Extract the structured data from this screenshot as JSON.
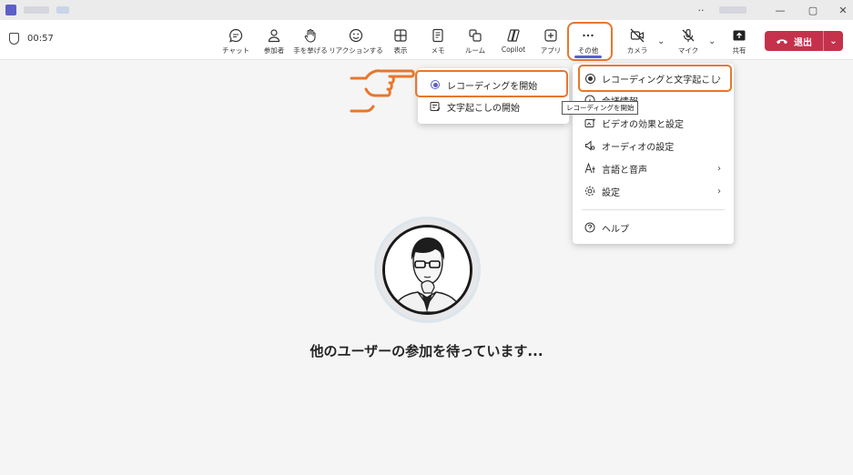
{
  "call": {
    "timer": "00:57"
  },
  "toolbar": {
    "items": [
      {
        "label": "チャット",
        "icon": "chat-icon"
      },
      {
        "label": "参加者",
        "icon": "people-icon"
      },
      {
        "label": "手を挙げる",
        "icon": "raise-hand-icon"
      },
      {
        "label": "リアクションする",
        "icon": "emoji-icon"
      },
      {
        "label": "表示",
        "icon": "grid-view-icon"
      },
      {
        "label": "メモ",
        "icon": "notes-icon"
      },
      {
        "label": "ルーム",
        "icon": "breakout-rooms-icon"
      },
      {
        "label": "Copilot",
        "icon": "copilot-icon"
      },
      {
        "label": "アプリ",
        "icon": "apps-icon"
      },
      {
        "label": "その他",
        "icon": "more-icon"
      },
      {
        "label": "カメラ",
        "icon": "camera-off-icon"
      },
      {
        "label": "マイク",
        "icon": "mic-off-icon"
      },
      {
        "label": "共有",
        "icon": "share-icon"
      }
    ],
    "leave_label": "退出"
  },
  "more_menu": {
    "items": [
      {
        "label": "レコーディングと文字起こし",
        "icon": "record-icon",
        "submenu": true
      },
      {
        "label": "会議情報",
        "icon": "info-icon",
        "submenu": false
      },
      {
        "label": "ビデオの効果と設定",
        "icon": "video-effects-icon",
        "submenu": false
      },
      {
        "label": "オーディオの設定",
        "icon": "speaker-icon",
        "submenu": false
      },
      {
        "label": "言語と音声",
        "icon": "language-icon",
        "submenu": true
      },
      {
        "label": "設定",
        "icon": "settings-icon",
        "submenu": true
      },
      {
        "label": "ヘルプ",
        "icon": "help-icon",
        "submenu": false
      }
    ]
  },
  "recording_submenu": {
    "items": [
      {
        "label": "レコーディングを開始",
        "icon": "record-radio-icon"
      },
      {
        "label": "文字起こしの開始",
        "icon": "transcript-icon"
      }
    ]
  },
  "tooltip": "レコーディングを開始",
  "main": {
    "waiting_text": "他のユーザーの参加を待っています..."
  },
  "colors": {
    "accent": "#5b5fc7",
    "leave": "#c4314b",
    "highlight": "#e8772e"
  }
}
